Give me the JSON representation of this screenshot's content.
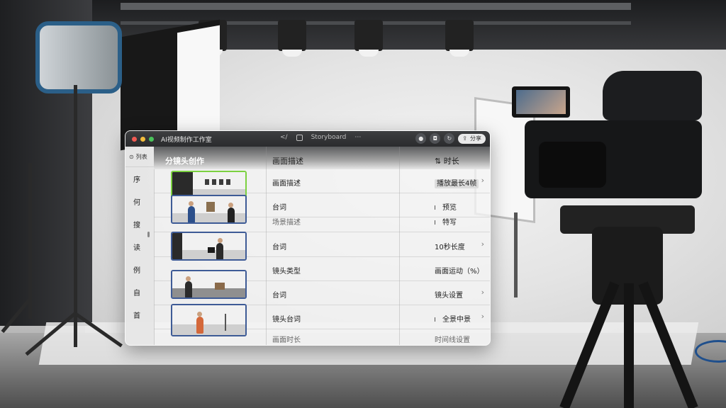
{
  "window": {
    "title": "AI视频制作工作室",
    "toolbar_center_label": "Storyboard",
    "toolbar_share_label": "分享"
  },
  "sidebar": {
    "header_label": "列表",
    "items": [
      "序",
      "何",
      "搜",
      "读",
      "例",
      "自",
      "首"
    ]
  },
  "table": {
    "headers": {
      "thumbnail": "分镜头创作",
      "description": "画面描述",
      "duration": "时长"
    },
    "rows": [
      {
        "description": "画面描述",
        "duration": "播放最长4帧",
        "selected": true,
        "chevron": true,
        "muted": false
      },
      {
        "description": "台词",
        "duration": "预览",
        "selected": false,
        "chevron": false,
        "muted": false
      },
      {
        "description": "场景描述",
        "duration": "特写",
        "selected": false,
        "chevron": false,
        "muted": true
      },
      {
        "description": "台词",
        "duration": "10秒长度",
        "selected": false,
        "chevron": true,
        "muted": false
      },
      {
        "description": "镜头类型",
        "duration": "画面运动（%）",
        "selected": false,
        "chevron": false,
        "muted": false
      },
      {
        "description": "台词",
        "duration": "镜头设置",
        "selected": false,
        "chevron": true,
        "muted": false
      },
      {
        "description": "镜头台词",
        "duration": "全景中景",
        "selected": false,
        "chevron": true,
        "muted": false
      },
      {
        "description": "画面时长",
        "duration": "时间线设置",
        "selected": false,
        "chevron": false,
        "muted": true
      }
    ]
  },
  "colors": {
    "selected_border": "#7bd140",
    "thumb_border": "#3e5b96",
    "traffic_red": "#f05a53",
    "traffic_yellow": "#f2bc3c",
    "traffic_green": "#49c35a"
  }
}
